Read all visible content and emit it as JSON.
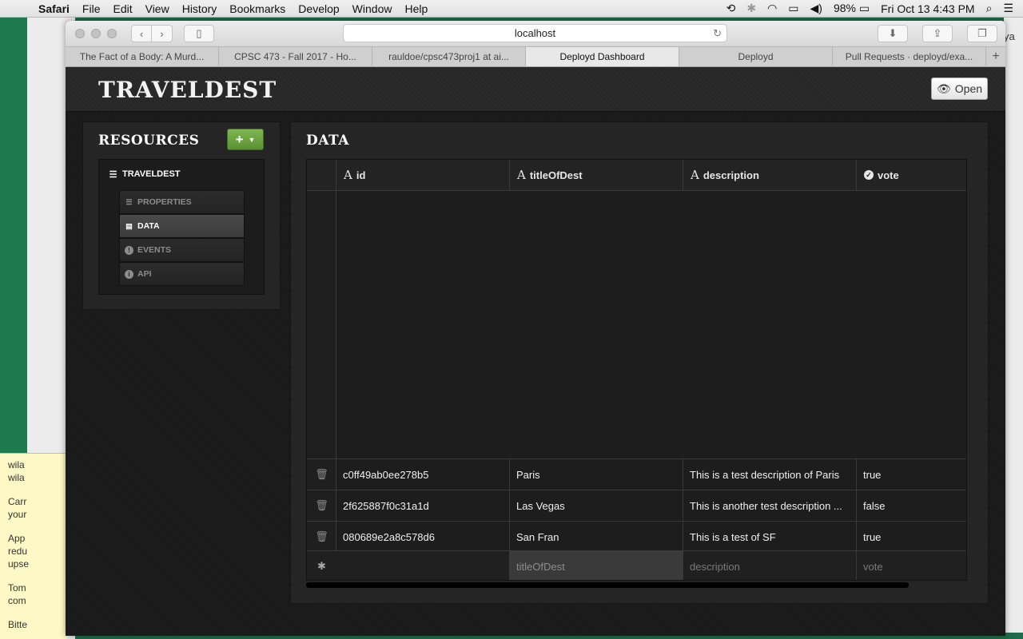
{
  "menubar": {
    "app": "Safari",
    "items": [
      "File",
      "Edit",
      "View",
      "History",
      "Bookmarks",
      "Develop",
      "Window",
      "Help"
    ],
    "battery": "98%",
    "clock": "Fri Oct 13  4:43 PM"
  },
  "browser": {
    "url": "localhost",
    "tabs": [
      "The Fact of a Body: A Murd...",
      "CPSC 473 - Fall 2017 - Ho...",
      "rauldoe/cpsc473proj1 at ai...",
      "Deployd Dashboard",
      "Deployd",
      "Pull Requests · deployd/exa..."
    ],
    "active_tab_index": 3
  },
  "dashboard": {
    "title": "TRAVELDEST",
    "open_label": "Open",
    "resources": {
      "title": "RESOURCES",
      "add_label": "+",
      "root": "TRAVELDEST",
      "items": [
        "PROPERTIES",
        "DATA",
        "EVENTS",
        "API"
      ],
      "active_item": "DATA"
    },
    "data": {
      "title": "DATA",
      "columns": [
        "id",
        "titleOfDest",
        "description",
        "vote"
      ],
      "rows": [
        {
          "id": "c0ff49ab0ee278b5",
          "titleOfDest": "Paris",
          "description": "This is a test description of Paris",
          "vote": "true"
        },
        {
          "id": "2f625887f0c31a1d",
          "titleOfDest": "Las Vegas",
          "description": "This is another test description ...",
          "vote": "false"
        },
        {
          "id": "080689e2a8c578d6",
          "titleOfDest": "San Fran",
          "description": "This is a test of SF",
          "vote": "true"
        }
      ],
      "new_row_placeholders": {
        "titleOfDest": "titleOfDest",
        "description": "description",
        "vote": "vote"
      }
    }
  },
  "desktop_note": {
    "lines": [
      "wila",
      "wila",
      "Carr",
      "your",
      "App",
      "redu",
      "upse",
      "Tom",
      "com",
      "Bitte"
    ]
  },
  "behind_window_text": "ya"
}
